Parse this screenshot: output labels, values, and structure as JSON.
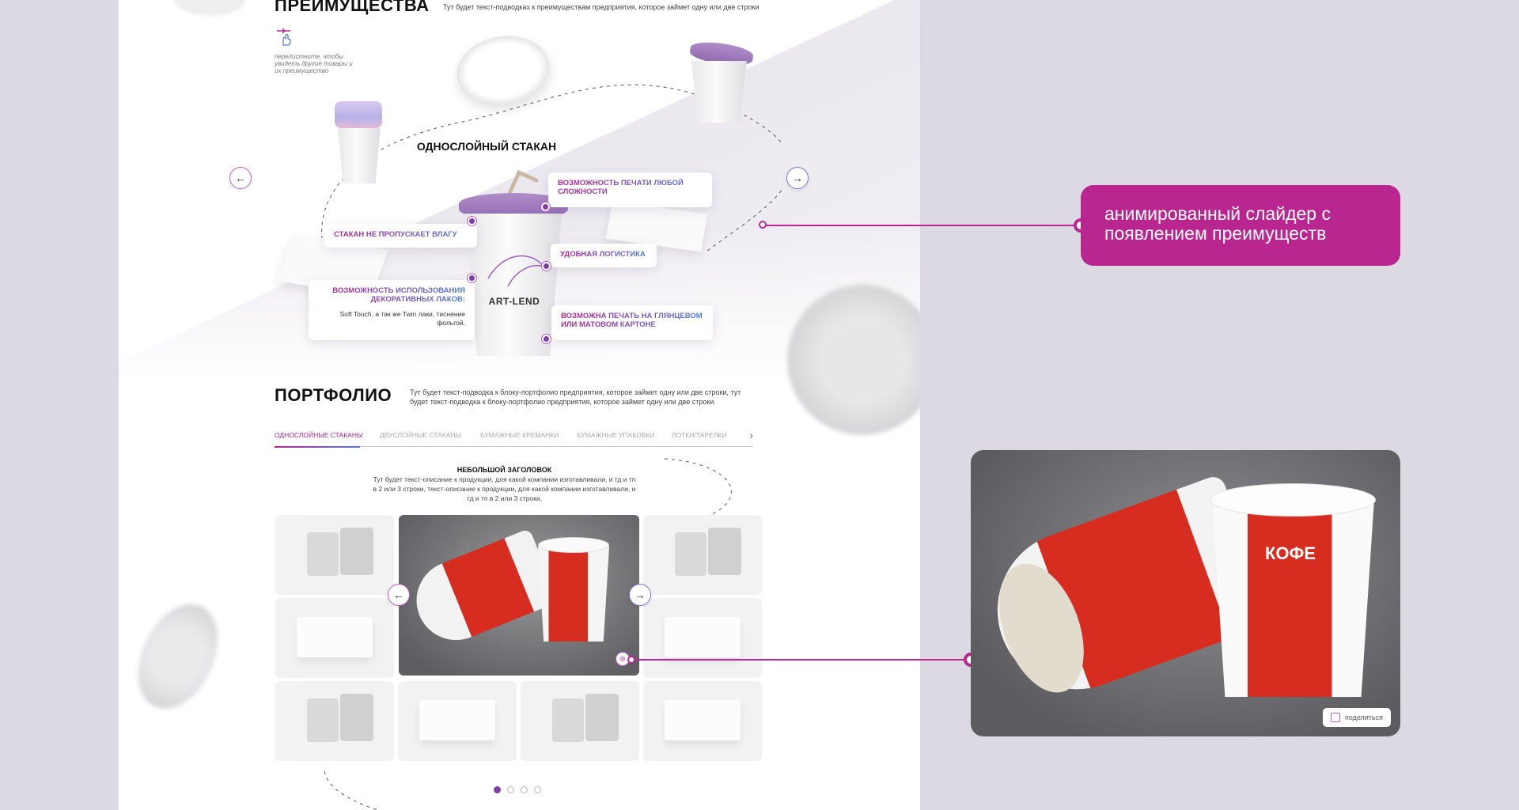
{
  "advantages": {
    "title": "ПРЕИМУЩЕСТВА",
    "subtitle": "Тут будет текст-подводках к преимуществам предприятия, которое займет одну или две строки",
    "hint": "перелистните, чтобы увидеть другие товары и их преимущество",
    "product_title": "ОДНОСЛОЙНЫЙ СТАКАН",
    "brand": "ART-LEND",
    "features": [
      {
        "title": "ВОЗМОЖНОСТЬ ПЕЧАТИ ЛЮБОЙ СЛОЖНОСТИ"
      },
      {
        "title": "СТАКАН НЕ ПРОПУСКАЕТ ВЛАГУ"
      },
      {
        "title": "УДОБНАЯ ЛОГИСТИКА"
      },
      {
        "title": "ВОЗМОЖНОСТЬ ИСПОЛЬЗОВАНИЯ ДЕКОРАТИВНЫХ ЛАКОВ:",
        "description": "Soft Touch, а так же Twin лаки, тиснение фольгой."
      },
      {
        "title": "ВОЗМОЖНА ПЕЧАТЬ НА ГЛЯНЦЕВОМ ИЛИ МАТОВОМ КАРТОНЕ"
      }
    ],
    "prev_arrow": "←",
    "next_arrow": "→"
  },
  "portfolio": {
    "title": "ПОРТФОЛИО",
    "subtitle": "Тут будет текст-подводка к блоку-портфолио предприятия, которое займет одну или две строки, тут будет текст-подводка к блоку-портфолио предприятия, которое займет одну или две строки.",
    "tabs": [
      "ОДНОСЛОЙНЫЕ СТАКАНЫ",
      "ДВУСЛОЙНЫЕ СТАКАНЫ",
      "БУМАЖНЫЕ КРЕМАНКИ",
      "БУМАЖНЫЕ УПАКОВКИ",
      "ЛОТКИ/ТАРЕЛКИ"
    ],
    "tabs_next": "›",
    "block_title": "НЕБОЛЬШОЙ ЗАГОЛОВОК",
    "block_text": "Тут будет текст-описание к продукции, для какой компании изготавливали, и тд и тп в 2 или 3 строки, текст-описание к продукции, для какой компании изготавливали, и тд и тп в 2 или 3 строки,",
    "prev_arrow": "←",
    "next_arrow": "→",
    "pages": 4,
    "active_page": 1
  },
  "annotation": {
    "text": "анимированный слайдер с появлением преимуществ"
  },
  "preview": {
    "share_label": "поделиться",
    "cup_label": "КОФЕ"
  },
  "colors": {
    "accent": "#b9268f",
    "accent_blue": "#5c7ad8",
    "background": "#dcd9e2"
  }
}
